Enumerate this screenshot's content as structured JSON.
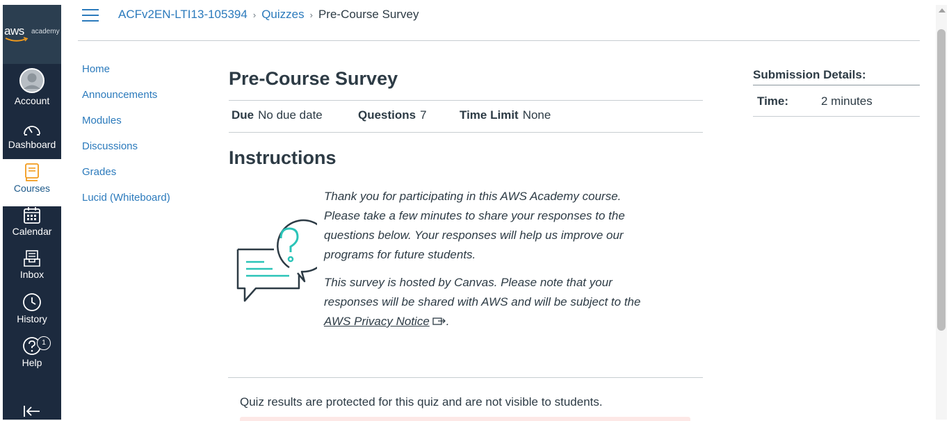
{
  "global_nav": {
    "logo_text": "aws",
    "logo_sub": "academy",
    "items": [
      {
        "label": "Account",
        "icon": "avatar-icon"
      },
      {
        "label": "Dashboard",
        "icon": "dashboard-icon"
      },
      {
        "label": "Courses",
        "icon": "courses-icon",
        "active": true
      },
      {
        "label": "Calendar",
        "icon": "calendar-icon"
      },
      {
        "label": "Inbox",
        "icon": "inbox-icon"
      },
      {
        "label": "History",
        "icon": "history-icon"
      },
      {
        "label": "Help",
        "icon": "help-icon",
        "badge": "1"
      }
    ]
  },
  "breadcrumb": {
    "course": "ACFv2EN-LTI13-105394",
    "section": "Quizzes",
    "current": "Pre-Course Survey",
    "separator": "›"
  },
  "course_nav": {
    "items": [
      "Home",
      "Announcements",
      "Modules",
      "Discussions",
      "Grades",
      "Lucid (Whiteboard)"
    ]
  },
  "quiz": {
    "title": "Pre-Course Survey",
    "due_label": "Due",
    "due_value": "No due date",
    "questions_label": "Questions",
    "questions_value": "7",
    "time_limit_label": "Time Limit",
    "time_limit_value": "None",
    "instructions_heading": "Instructions",
    "paragraph1": "Thank you for participating in this AWS Academy course. Please take a few minutes to share your responses to the questions below. Your responses will help us improve our programs for future students.",
    "paragraph2": "This survey is hosted by Canvas. Please note that your responses will be shared with AWS and will be subject to the",
    "privacy_link": "AWS Privacy Notice",
    "paragraph2_end": ".",
    "results_note": "Quiz results are protected for this quiz and are not visible to students."
  },
  "submission": {
    "title": "Submission Details:",
    "time_label": "Time:",
    "time_value": "2 minutes"
  },
  "colors": {
    "nav_bg": "#1c2a3e",
    "link": "#2b7abc",
    "accent_teal": "#2bc4b8"
  }
}
